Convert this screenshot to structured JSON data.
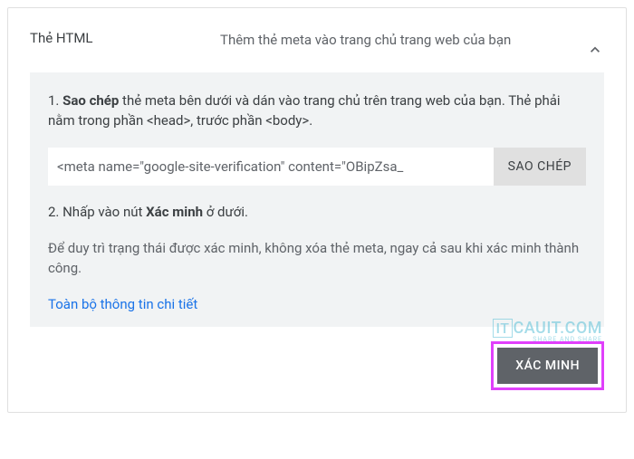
{
  "header": {
    "title": "Thẻ HTML",
    "description": "Thêm thẻ meta vào trang chủ trang web của bạn"
  },
  "content": {
    "step1_prefix": "1. ",
    "step1_bold": "Sao chép",
    "step1_rest": " thẻ meta bên dưới và dán vào trang chủ trên trang web của bạn. Thẻ phải nằm trong phần <head>, trước phần <body>.",
    "code_value": "<meta name=\"google-site-verification\" content=\"OBipZsa_",
    "copy_label": "SAO CHÉP",
    "step2_prefix": "2. Nhấp vào nút ",
    "step2_bold": "Xác minh",
    "step2_rest": " ở dưới.",
    "maintain_text": "Để duy trì trạng thái được xác minh, không xóa thẻ meta, ngay cả sau khi xác minh thành công.",
    "details_link": "Toàn bộ thông tin chi tiết"
  },
  "footer": {
    "verify_label": "XÁC MINH"
  },
  "watermark": {
    "brand_prefix": "IT",
    "brand_rest": "CAUIT.COM",
    "tagline": "SHARE AND SHARE"
  }
}
